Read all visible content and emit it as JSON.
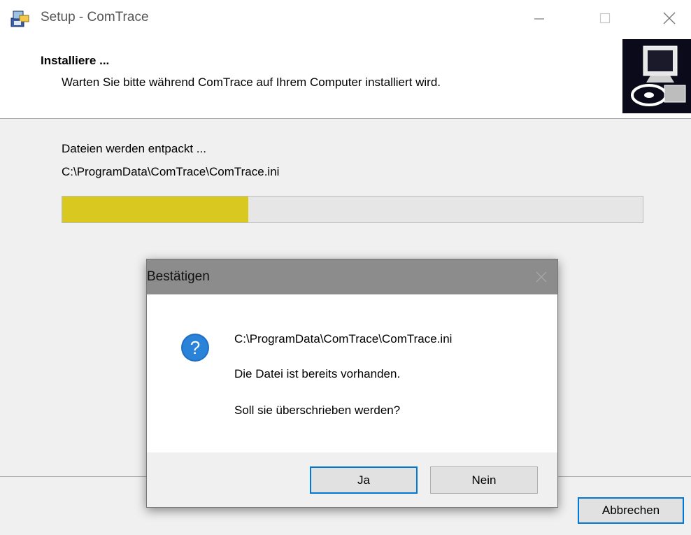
{
  "window": {
    "title": "Setup - ComTrace",
    "icon": "setup-installer-icon"
  },
  "header": {
    "title": "Installiere ...",
    "subtitle": "Warten Sie bitte während ComTrace auf Ihrem Computer installiert wird.",
    "logo_icon": "computer-disk-icon"
  },
  "status": {
    "action": "Dateien werden entpackt ...",
    "path": "C:\\ProgramData\\ComTrace\\ComTrace.ini"
  },
  "progress": {
    "percent": 32,
    "color": "#d8c820"
  },
  "footer": {
    "cancel_label": "Abbrechen"
  },
  "dialog": {
    "title": "Bestätigen",
    "icon": "question-icon",
    "file_path": "C:\\ProgramData\\ComTrace\\ComTrace.ini",
    "message": "Die Datei ist bereits vorhanden.",
    "question": "Soll sie überschrieben werden?",
    "yes_label": "Ja",
    "no_label": "Nein"
  },
  "colors": {
    "accent": "#0078d7",
    "progress": "#d8c820"
  }
}
